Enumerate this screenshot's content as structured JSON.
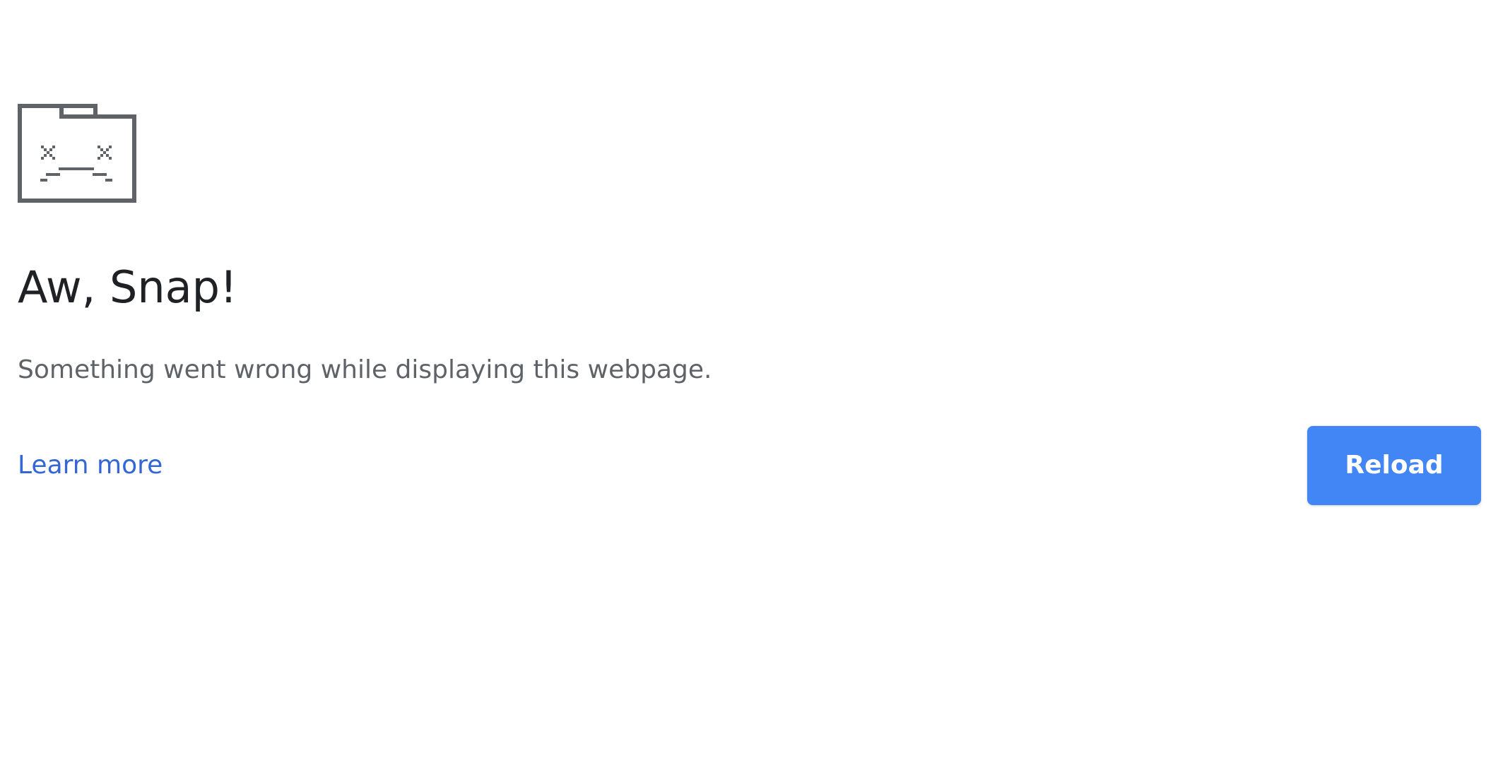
{
  "error_page": {
    "icon": "sad-tab-icon",
    "title": "Aw, Snap!",
    "message": "Something went wrong while displaying this webpage.",
    "learn_more_label": "Learn more",
    "reload_label": "Reload"
  },
  "colors": {
    "background": "#ffffff",
    "icon": "#5f6368",
    "title": "#202124",
    "message": "#5f6368",
    "link": "#3367d6",
    "button": "#4285f4",
    "button_text": "#ffffff"
  }
}
